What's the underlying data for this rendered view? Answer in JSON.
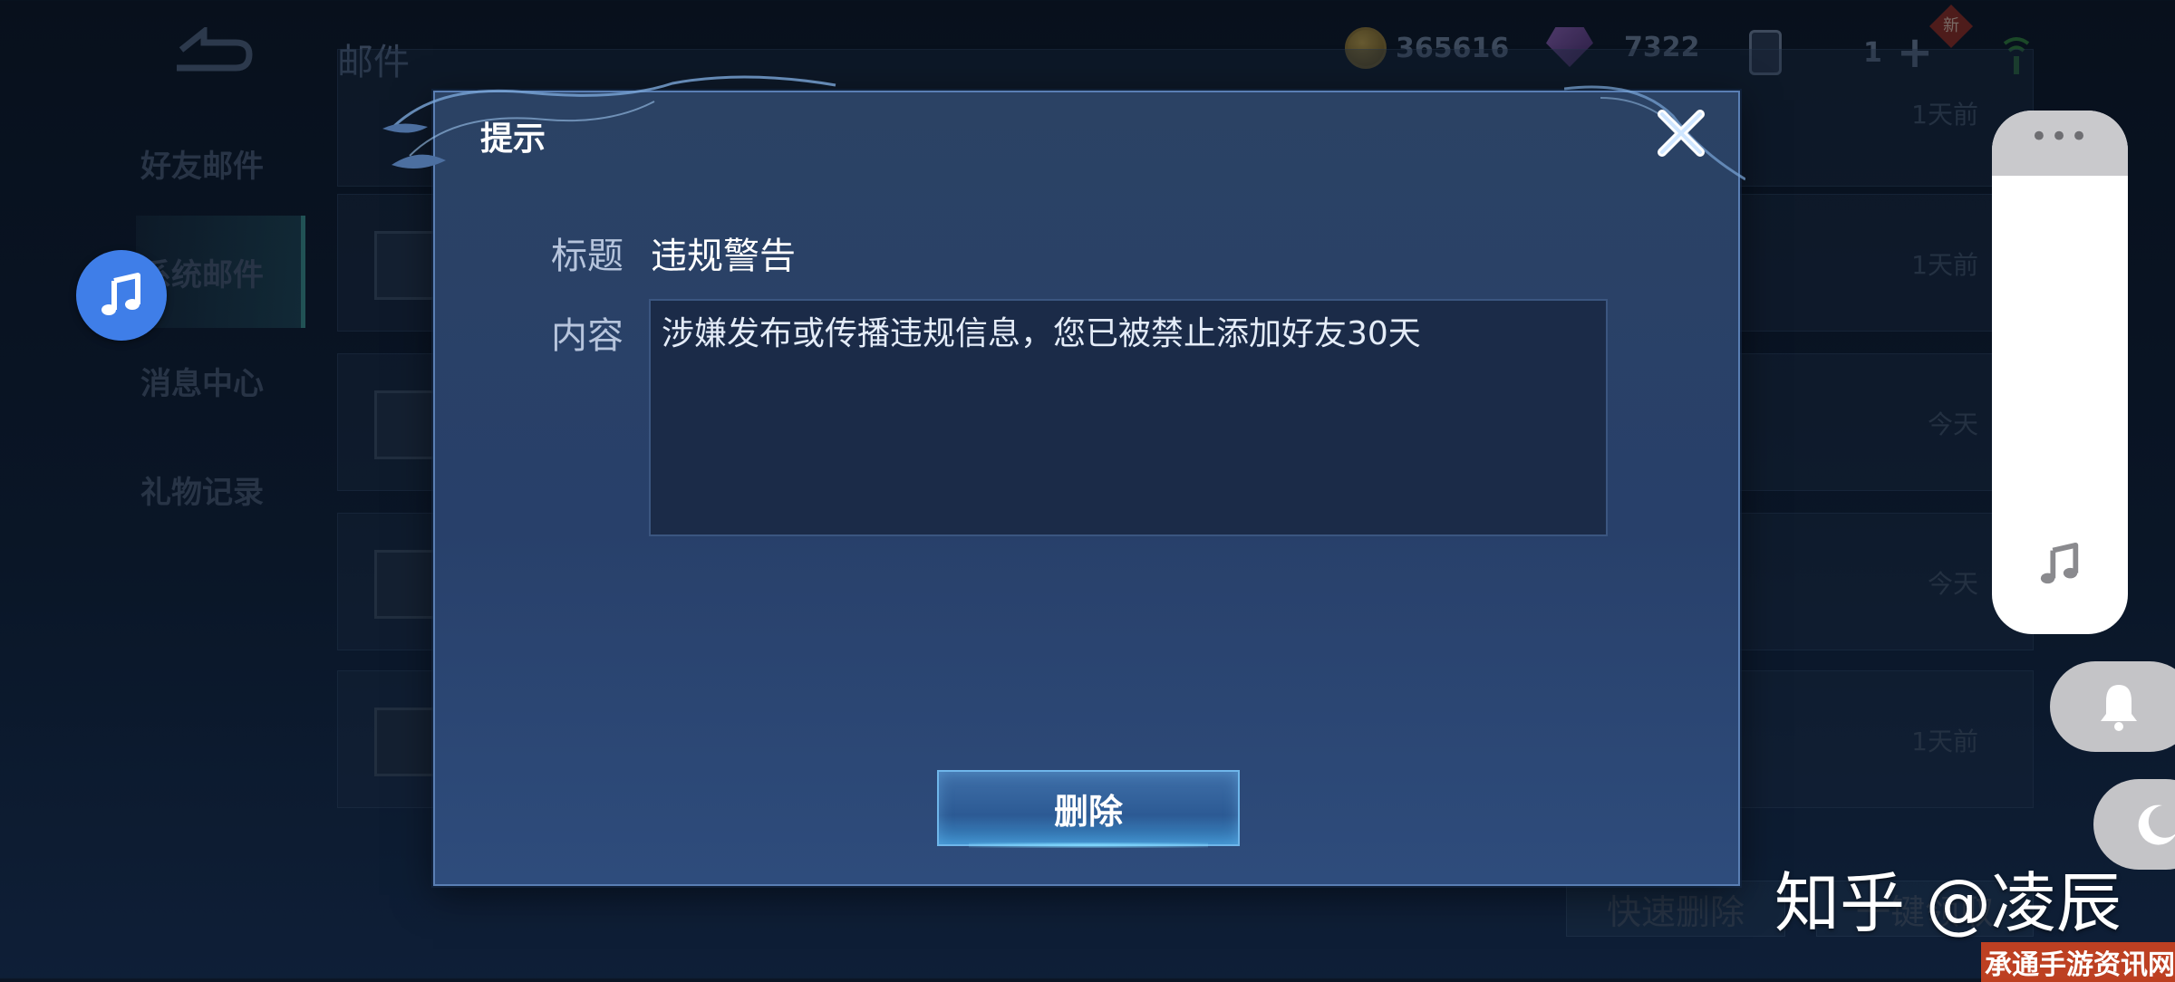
{
  "header": {
    "title": "邮件",
    "gold": "365616",
    "gems": "7322",
    "tickets": "1",
    "new_badge": "新"
  },
  "sidebar": {
    "items": [
      {
        "label": "好友邮件"
      },
      {
        "label": "系统邮件"
      },
      {
        "label": "消息中心"
      },
      {
        "label": "礼物记录"
      }
    ]
  },
  "mail_list": {
    "times": [
      "1天前",
      "1天前",
      "今天",
      "今天",
      "1天前"
    ]
  },
  "bottom": {
    "quick_delete": "快速删除",
    "quick_claim": "一键领取"
  },
  "dialog": {
    "title": "提示",
    "subject_label": "标题",
    "subject_value": "违规警告",
    "content_label": "内容",
    "content_value": "涉嫌发布或传播违规信息，您已被禁止添加好友30天",
    "delete_label": "删除"
  },
  "overlay": {
    "watermark": "知乎 @凌辰",
    "site_mark": "承通手游资讯网"
  },
  "colors": {
    "accent": "#3f7ee8",
    "dialog_bg": "#2b4264",
    "button": "#2c5a94"
  }
}
